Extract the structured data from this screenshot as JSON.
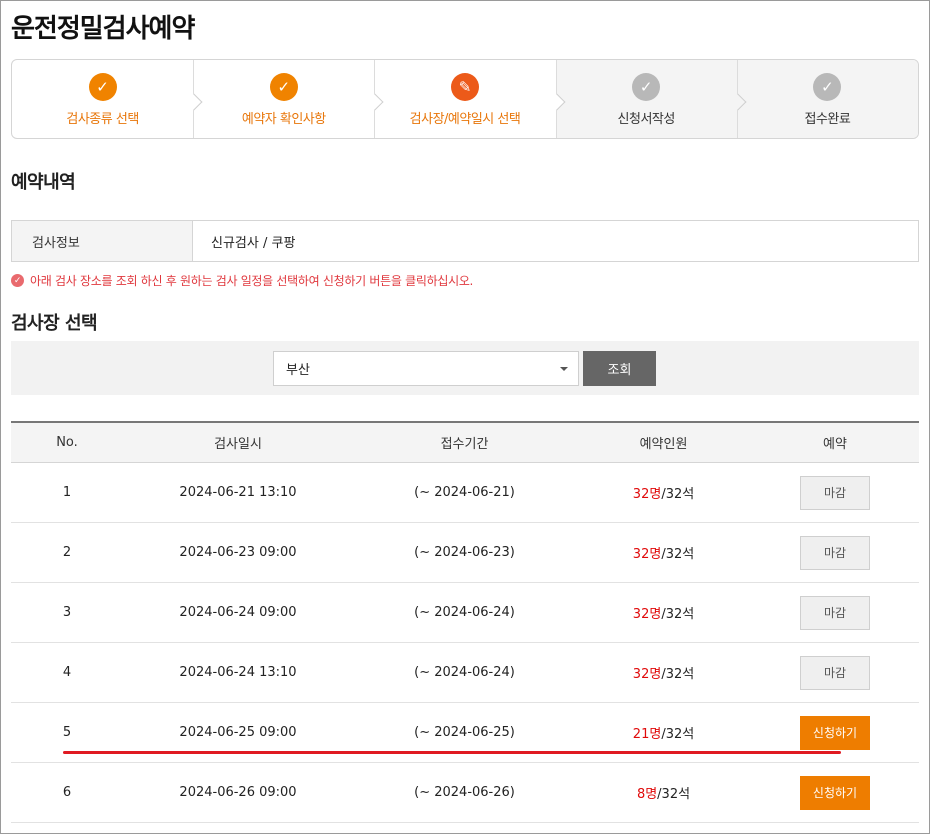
{
  "page_title": "운전정밀검사예약",
  "steps": [
    {
      "label": "검사종류 선택",
      "state": "done",
      "icon": "check-icon"
    },
    {
      "label": "예약자 확인사항",
      "state": "done",
      "icon": "check-icon"
    },
    {
      "label": "검사장/예약일시 선택",
      "state": "current",
      "icon": "pencil-icon"
    },
    {
      "label": "신청서작성",
      "state": "pending",
      "icon": "check-icon"
    },
    {
      "label": "접수완료",
      "state": "pending",
      "icon": "check-icon"
    }
  ],
  "reservation": {
    "title": "예약내역",
    "info_label": "검사정보",
    "info_value": "신규검사 / 쿠팡"
  },
  "notice": "아래 검사 장소를 조회 하신 후 원하는 검사 일정을 선택하여 신청하기 버튼을 클릭하십시오.",
  "center_select": {
    "title": "검사장 선택",
    "selected": "부산",
    "search_button": "조회"
  },
  "table": {
    "headers": [
      "No.",
      "검사일시",
      "접수기간",
      "예약인원",
      "예약"
    ],
    "rows": [
      {
        "no": "1",
        "datetime": "2024-06-21 13:10",
        "period": "(~ 2024-06-21)",
        "booked": "32명",
        "capacity": "/32석",
        "action": "마감",
        "status": "closed"
      },
      {
        "no": "2",
        "datetime": "2024-06-23 09:00",
        "period": "(~ 2024-06-23)",
        "booked": "32명",
        "capacity": "/32석",
        "action": "마감",
        "status": "closed"
      },
      {
        "no": "3",
        "datetime": "2024-06-24 09:00",
        "period": "(~ 2024-06-24)",
        "booked": "32명",
        "capacity": "/32석",
        "action": "마감",
        "status": "closed"
      },
      {
        "no": "4",
        "datetime": "2024-06-24 13:10",
        "period": "(~ 2024-06-24)",
        "booked": "32명",
        "capacity": "/32석",
        "action": "마감",
        "status": "closed"
      },
      {
        "no": "5",
        "datetime": "2024-06-25 09:00",
        "period": "(~ 2024-06-25)",
        "booked": "21명",
        "capacity": "/32석",
        "action": "신청하기",
        "status": "open"
      },
      {
        "no": "6",
        "datetime": "2024-06-26 09:00",
        "period": "(~ 2024-06-26)",
        "booked": "8명",
        "capacity": "/32석",
        "action": "신청하기",
        "status": "open"
      }
    ]
  },
  "colors": {
    "accent": "#f08300",
    "current_step": "#ec5a19",
    "booked_count": "#e00a0a",
    "highlight_line": "#e01a22"
  }
}
